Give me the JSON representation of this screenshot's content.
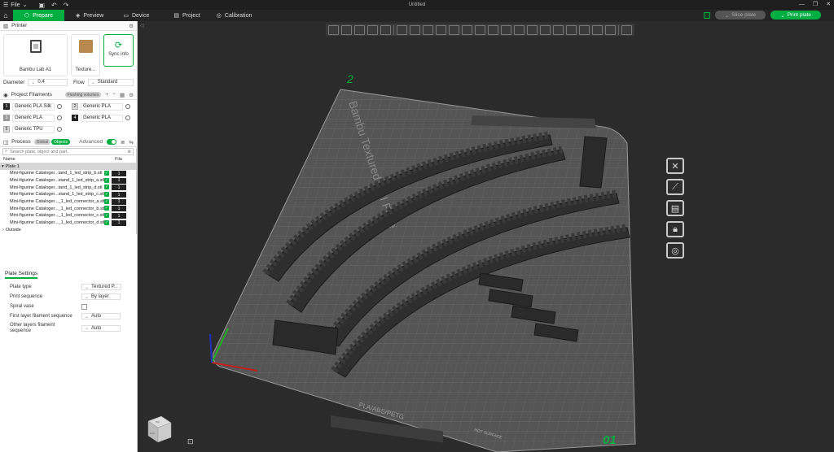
{
  "titlebar": {
    "menu_label": "File",
    "title": "Untitled"
  },
  "nav": {
    "tabs": [
      {
        "label": "Prepare",
        "icon": "cube-icon"
      },
      {
        "label": "Preview",
        "icon": "layers-icon"
      },
      {
        "label": "Device",
        "icon": "monitor-icon"
      },
      {
        "label": "Project",
        "icon": "project-icon"
      },
      {
        "label": "Calibration",
        "icon": "calibration-icon"
      }
    ],
    "slice_label": "Slice plate",
    "print_label": "Print plate"
  },
  "printer": {
    "section_title": "Printer",
    "printer_name": "Bambu Lab A1",
    "plate_name": "Texture...",
    "sync_label": "Sync info",
    "diameter_label": "Diameter",
    "diameter_value": "0.4",
    "flow_label": "Flow",
    "flow_value": "Standard"
  },
  "filaments": {
    "section_title": "Project Filaments",
    "flushing_label": "Flushing volumes",
    "items": [
      {
        "num": "1",
        "name": "Generic PLA Silk"
      },
      {
        "num": "2",
        "name": "Generic PLA"
      },
      {
        "num": "3",
        "name": "Generic PLA"
      },
      {
        "num": "4",
        "name": "Generic PLA"
      },
      {
        "num": "5",
        "name": "Generic TPU"
      }
    ]
  },
  "process": {
    "section_title": "Process",
    "global_label": "Global",
    "objects_label": "Objects",
    "advanced_label": "Advanced",
    "search_placeholder": "Search plate, object and part.",
    "col_name": "Name",
    "col_fila": "Fila",
    "plate_label": "Plate 1",
    "objects": [
      {
        "name": "Mini-figurine Cataloger...tand_1_led_strip_b.stl",
        "fila": "1"
      },
      {
        "name": "Mini-figurine Cataloger...stand_1_led_strip_a.stl",
        "fila": "1"
      },
      {
        "name": "Mini-figurine Cataloger...tand_1_led_strip_d.stl",
        "fila": "1"
      },
      {
        "name": "Mini-figurine Cataloger...stand_1_led_strip_c.stl",
        "fila": "1"
      },
      {
        "name": "Mini-figurine Cataloger..._1_led_connector_a.stl",
        "fila": "1"
      },
      {
        "name": "Mini-figurine Cataloger..._1_led_connector_b.stl",
        "fila": "1"
      },
      {
        "name": "Mini-figurine Cataloger..._1_led_connector_c.stl",
        "fila": "1"
      },
      {
        "name": "Mini-figurine Cataloger..._1_led_connector_d.stl",
        "fila": "1"
      }
    ],
    "outside_label": "Outside"
  },
  "plate_settings": {
    "title": "Plate Settings",
    "rows": [
      {
        "label": "Plate type",
        "value": "Textured P..."
      },
      {
        "label": "Print sequence",
        "value": "By layer"
      },
      {
        "label": "Spiral vase",
        "value": ""
      },
      {
        "label": "First layer filament sequence",
        "value": "Auto"
      },
      {
        "label": "Other layers filament sequence",
        "value": "Auto"
      }
    ]
  },
  "viewport": {
    "bed_label": "Bambu Textured PEI Plate",
    "material_label": "PLA/ABS/PETG",
    "hot_surface_label": "HOT SURFACE",
    "plate_number": "01",
    "corner_mark": "2",
    "viewcube_top": "Top",
    "viewcube_front": "Front",
    "colors": {
      "bg": "#2b2b2b",
      "bed": "#555555",
      "accent": "#00ae42",
      "plate_number": "#00ae42"
    }
  }
}
